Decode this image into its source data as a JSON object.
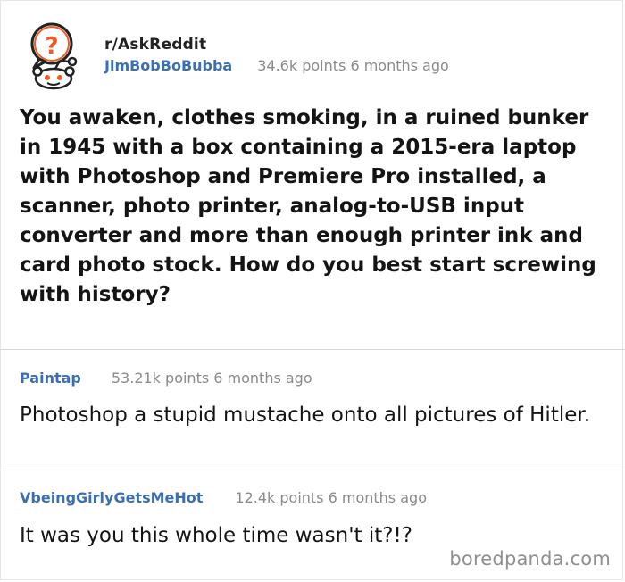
{
  "post": {
    "subreddit": "r/AskReddit",
    "author": "JimBobBoBubba",
    "meta": "34.6k points 6 months ago",
    "title": "You awaken, clothes smoking, in a ruined bunker in 1945 with a box containing a 2015-era laptop with Photoshop and Premiere Pro installed, a scanner, photo printer, analog-to-USB input converter and more than enough printer ink and card photo stock. How do you best start screwing with history?",
    "avatar_icon": "reddit-snoo-question-icon"
  },
  "comments": [
    {
      "author": "Paintap",
      "meta": "53.21k points 6 months ago",
      "body": "Photoshop a stupid mustache onto all pictures of Hitler."
    },
    {
      "author": "VbeingGirlyGetsMeHot",
      "meta": "12.4k points 6 months ago",
      "body": "It was you this whole time wasn't it?!?"
    }
  ],
  "watermark": "boredpanda.com",
  "colors": {
    "username": "#3a6fb2",
    "meta": "#8a8a8a",
    "snoo_ring": "#f15a24",
    "text": "#141414"
  }
}
